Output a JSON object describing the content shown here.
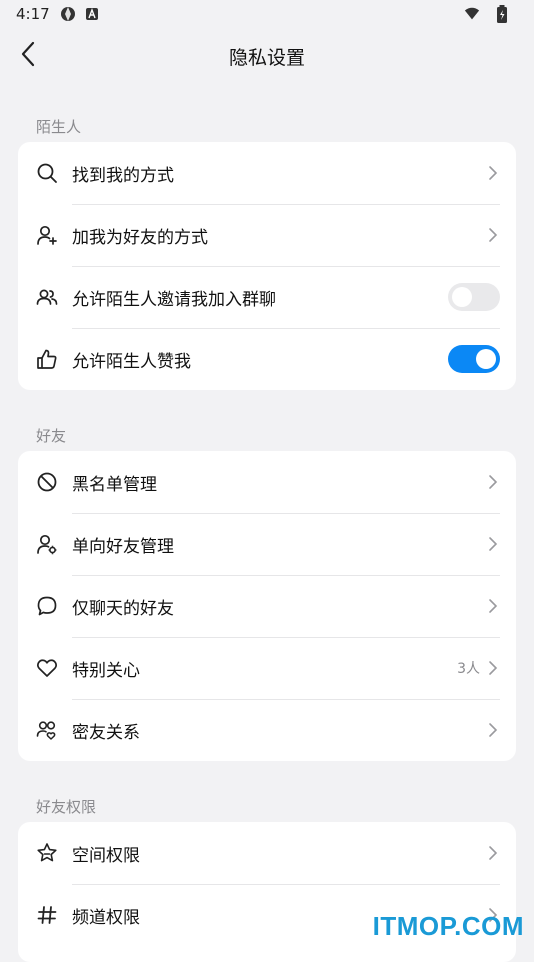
{
  "status_bar": {
    "time": "4:17"
  },
  "header": {
    "title": "隐私设置"
  },
  "sections": [
    {
      "label": "陌生人",
      "items": [
        {
          "label": "找到我的方式",
          "icon": "search-icon",
          "type": "link"
        },
        {
          "label": "加我为好友的方式",
          "icon": "add-friend-icon",
          "type": "link"
        },
        {
          "label": "允许陌生人邀请我加入群聊",
          "icon": "group-icon",
          "type": "toggle",
          "on": false
        },
        {
          "label": "允许陌生人赞我",
          "icon": "thumbs-up-icon",
          "type": "toggle",
          "on": true
        }
      ]
    },
    {
      "label": "好友",
      "items": [
        {
          "label": "黑名单管理",
          "icon": "block-icon",
          "type": "link"
        },
        {
          "label": "单向好友管理",
          "icon": "user-settings-icon",
          "type": "link"
        },
        {
          "label": "仅聊天的好友",
          "icon": "chat-bubble-icon",
          "type": "link"
        },
        {
          "label": "特别关心",
          "icon": "heart-icon",
          "type": "link",
          "extra": "3人"
        },
        {
          "label": "密友关系",
          "icon": "close-friends-icon",
          "type": "link"
        }
      ]
    },
    {
      "label": "好友权限",
      "items": [
        {
          "label": "空间权限",
          "icon": "star-house-icon",
          "type": "link"
        },
        {
          "label": "频道权限",
          "icon": "hash-icon",
          "type": "link"
        }
      ]
    }
  ],
  "watermark": "ITMOP.COM",
  "colors": {
    "accent": "#0b88f5",
    "background": "#f2f2f4",
    "muted": "#8a8a8e"
  }
}
